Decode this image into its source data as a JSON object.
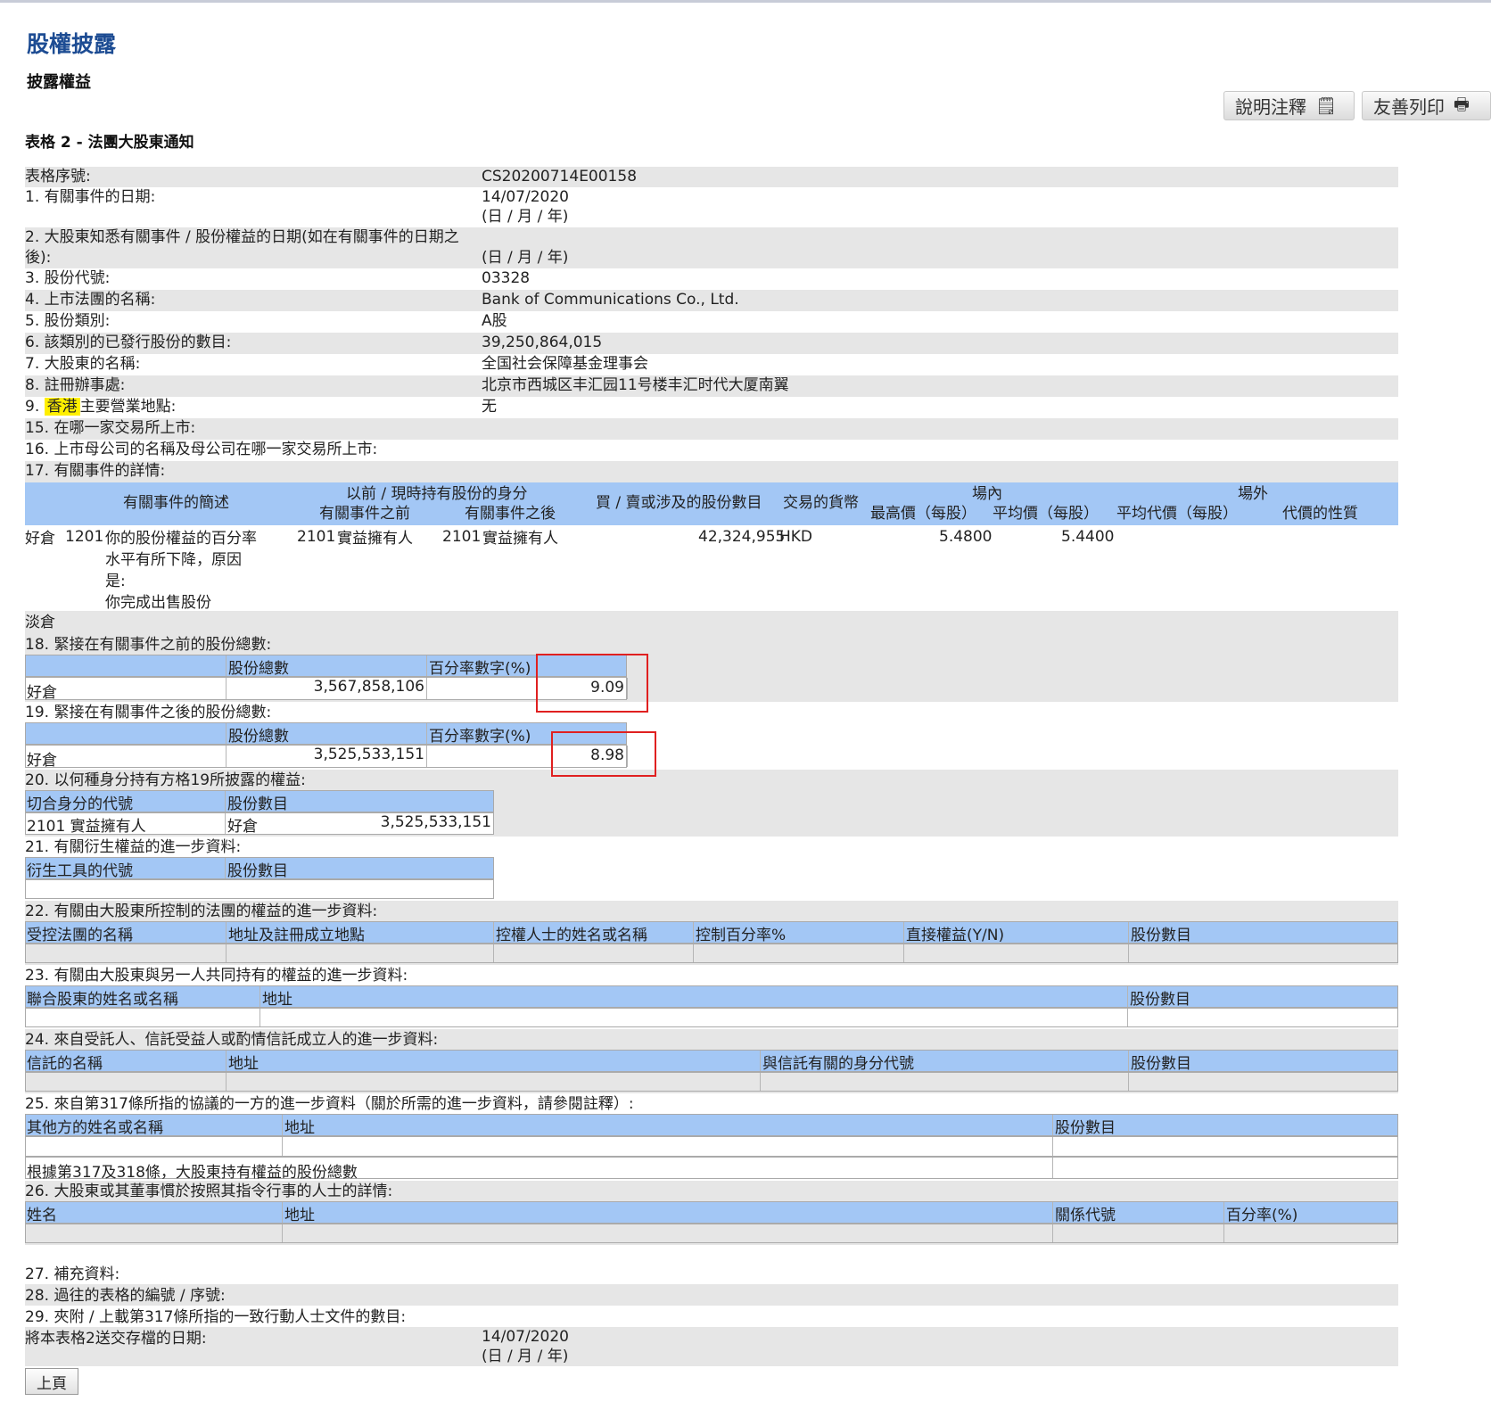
{
  "header": {
    "title": "股權披露",
    "subtitle": "披露權益",
    "form_title": "表格 2 - 法團大股東通知",
    "btn_notes": "說明注釋",
    "btn_print": "友善列印"
  },
  "rows": {
    "form_no": {
      "label": "表格序號:",
      "value": "CS20200714E00158"
    },
    "r1": {
      "label": "1. 有關事件的日期:",
      "value": "14/07/2020",
      "sub": "(日 / 月 / 年)"
    },
    "r2": {
      "label_a": "2. 大股東知悉有關事件 / 股份權益的日期(如在有關事件的日期之",
      "label_b": "後):",
      "sub": "(日 / 月 / 年)"
    },
    "r3": {
      "label": "3. 股份代號:",
      "value": "03328"
    },
    "r4": {
      "label": "4. 上市法團的名稱:",
      "value": "Bank of Communications Co., Ltd."
    },
    "r5": {
      "label": "5. 股份類別:",
      "value": "A股"
    },
    "r6": {
      "label": "6. 該類別的已發行股份的數目:",
      "value": "39,250,864,015"
    },
    "r7": {
      "label": "7. 大股東的名稱:",
      "value": "全国社会保障基金理事会"
    },
    "r8": {
      "label": "8. 註冊辦事處:",
      "value": "北京市西城区丰汇园11号楼丰汇时代大厦南翼"
    },
    "r9": {
      "num": "9.",
      "hl": "香港",
      "label": "主要營業地點:",
      "value": "无"
    },
    "r15": {
      "label": "15. 在哪一家交易所上市:"
    },
    "r16": {
      "label": "16. 上市母公司的名稱及母公司在哪一家交易所上市:"
    },
    "r17": {
      "label": "17. 有關事件的詳情:"
    }
  },
  "s17": {
    "h_desc": "有關事件的簡述",
    "h_cap_top": "以前 / 現時持有股份的身分",
    "h_before": "有關事件之前",
    "h_after": "有關事件之後",
    "h_shares": "買 / 賣或涉及的股份數目",
    "h_ccy": "交易的貨幣",
    "h_onex": "場內",
    "h_offex": "場外",
    "h_high": "最高價（每股）",
    "h_avg": "平均價（每股）",
    "h_avgc": "平均代價（每股）",
    "h_nature": "代價的性質",
    "row": {
      "pos": "好倉",
      "code": "1201",
      "desc_1": "你的股份權益的百分率",
      "desc_2": "水平有所下降，原因",
      "desc_3": "是:",
      "desc_4": "你完成出售股份",
      "bef_code": "2101",
      "bef_cap": "實益擁有人",
      "aft_code": "2101",
      "aft_cap": "實益擁有人",
      "shares": "42,324,955",
      "ccy": "HKD",
      "high": "5.4800",
      "avg": "5.4400"
    },
    "short": "淡倉"
  },
  "s18": {
    "label": "18. 緊接在有關事件之前的股份總數:",
    "h_total": "股份總數",
    "h_pct": "百分率數字(%)",
    "pos": "好倉",
    "total": "3,567,858,106",
    "pct": "9.09"
  },
  "s19": {
    "label": "19. 緊接在有關事件之後的股份總數:",
    "h_total": "股份總數",
    "h_pct": "百分率數字(%)",
    "pos": "好倉",
    "total": "3,525,533,151",
    "pct": "8.98"
  },
  "s20": {
    "label": "20. 以何種身分持有方格19所披露的權益:",
    "h_code": "切合身分的代號",
    "h_num": "股份數目",
    "code": "2101",
    "cap": "實益擁有人",
    "pos": "好倉",
    "num": "3,525,533,151"
  },
  "s21": {
    "label": "21. 有關衍生權益的進一步資料:",
    "h_code": "衍生工具的代號",
    "h_num": "股份數目"
  },
  "s22": {
    "label": "22. 有關由大股東所控制的法團的權益的進一步資料:",
    "h1": "受控法團的名稱",
    "h2": "地址及註冊成立地點",
    "h3": "控權人士的姓名或名稱",
    "h4": "控制百分率%",
    "h5": "直接權益(Y/N)",
    "h6": "股份數目"
  },
  "s23": {
    "label": "23. 有關由大股東與另一人共同持有的權益的進一步資料:",
    "h1": "聯合股東的姓名或名稱",
    "h2": "地址",
    "h3": "股份數目"
  },
  "s24": {
    "label": "24. 來自受託人、信託受益人或酌情信託成立人的進一步資料:",
    "h1": "信託的名稱",
    "h2": "地址",
    "h3": "與信託有關的身分代號",
    "h4": "股份數目"
  },
  "s25": {
    "label": "25. 來自第317條所指的協議的一方的進一步資料（關於所需的進一步資料，請參閱註釋）:",
    "h1": "其他方的姓名或名稱",
    "h2": "地址",
    "h3": "股份數目",
    "total": "根據第317及318條，大股東持有權益的股份總數"
  },
  "s26": {
    "label": "26. 大股東或其董事慣於按照其指令行事的人士的詳情:",
    "h1": "姓名",
    "h2": "地址",
    "h3": "關係代號",
    "h4": "百分率(%)"
  },
  "s27": {
    "label": "27. 補充資料:"
  },
  "s28": {
    "label": "28. 過往的表格的編號 / 序號:"
  },
  "s29": {
    "label": "29. 夾附 / 上載第317條所指的一致行動人士文件的數目:"
  },
  "sfile": {
    "label": "將本表格2送交存檔的日期:",
    "value": "14/07/2020",
    "sub": "(日 / 月 / 年)"
  },
  "back_button": "上頁"
}
